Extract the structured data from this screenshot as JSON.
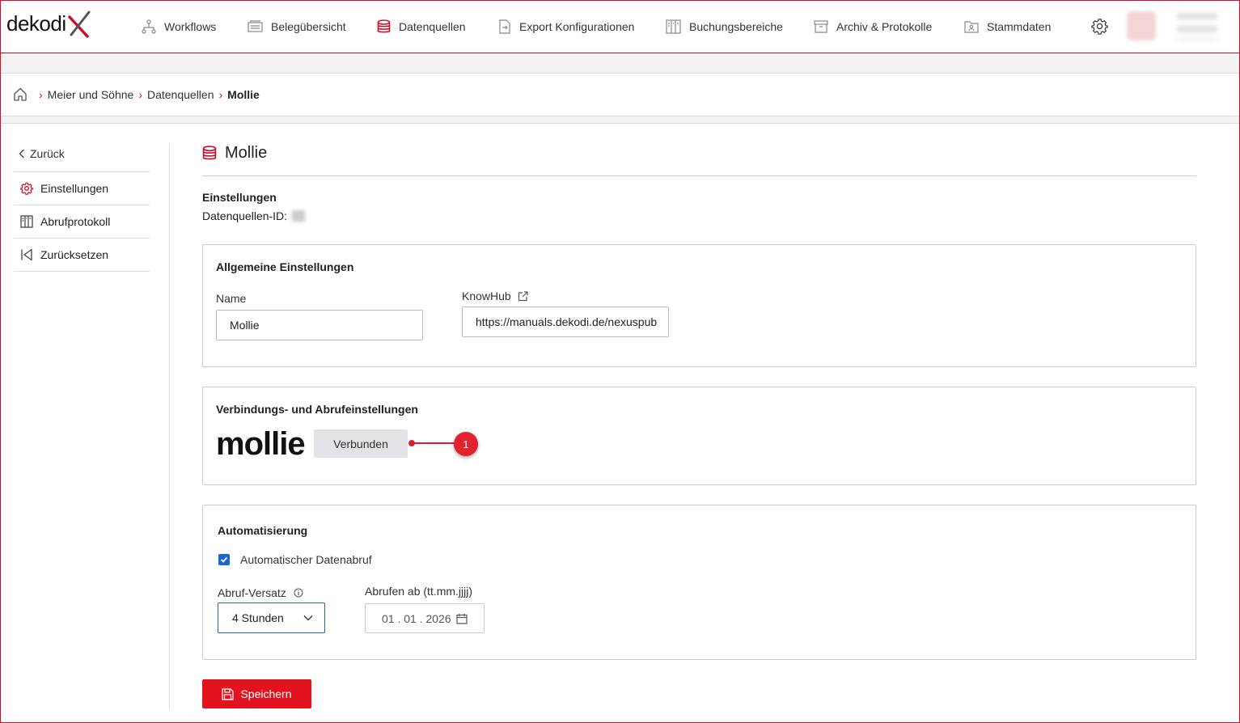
{
  "brand": {
    "name": "dekodi",
    "accent": "#c8102e"
  },
  "nav": {
    "items": [
      {
        "label": "Workflows",
        "icon": "workflow-icon"
      },
      {
        "label": "Belegübersicht",
        "icon": "documents-icon"
      },
      {
        "label": "Datenquellen",
        "icon": "database-icon",
        "active": true
      },
      {
        "label": "Export Konfigurationen",
        "icon": "export-icon"
      },
      {
        "label": "Buchungsbereiche",
        "icon": "booking-icon"
      },
      {
        "label": "Archiv & Protokolle",
        "icon": "archive-icon"
      },
      {
        "label": "Stammdaten",
        "icon": "master-data-icon"
      }
    ]
  },
  "breadcrumb": [
    "Meier und Söhne",
    "Datenquellen",
    "Mollie"
  ],
  "sidebar": {
    "back_label": "Zurück",
    "items": [
      {
        "label": "Einstellungen",
        "icon": "gear-icon"
      },
      {
        "label": "Abrufprotokoll",
        "icon": "log-icon"
      },
      {
        "label": "Zurücksetzen",
        "icon": "reset-icon"
      }
    ]
  },
  "page": {
    "title": "Mollie",
    "section_heading": "Einstellungen",
    "datasource_id_label": "Datenquellen-ID:"
  },
  "general": {
    "title": "Allgemeine Einstellungen",
    "name_label": "Name",
    "name_value": "Mollie",
    "knowhub_label": "KnowHub",
    "knowhub_value": "https://manuals.dekodi.de/nexuspub"
  },
  "connection": {
    "title": "Verbindungs- und Abrufeinstellungen",
    "provider_logo_text": "mollie",
    "status_button": "Verbunden",
    "callout_number": "1"
  },
  "automation": {
    "title": "Automatisierung",
    "auto_fetch_label": "Automatischer Datenabruf",
    "auto_fetch_checked": true,
    "offset_label": "Abruf-Versatz",
    "offset_value": "4 Stunden",
    "fetch_from_label": "Abrufen ab (tt.mm.jjjj)",
    "fetch_from_value": "01 . 01 . 2026"
  },
  "actions": {
    "save_label": "Speichern"
  }
}
